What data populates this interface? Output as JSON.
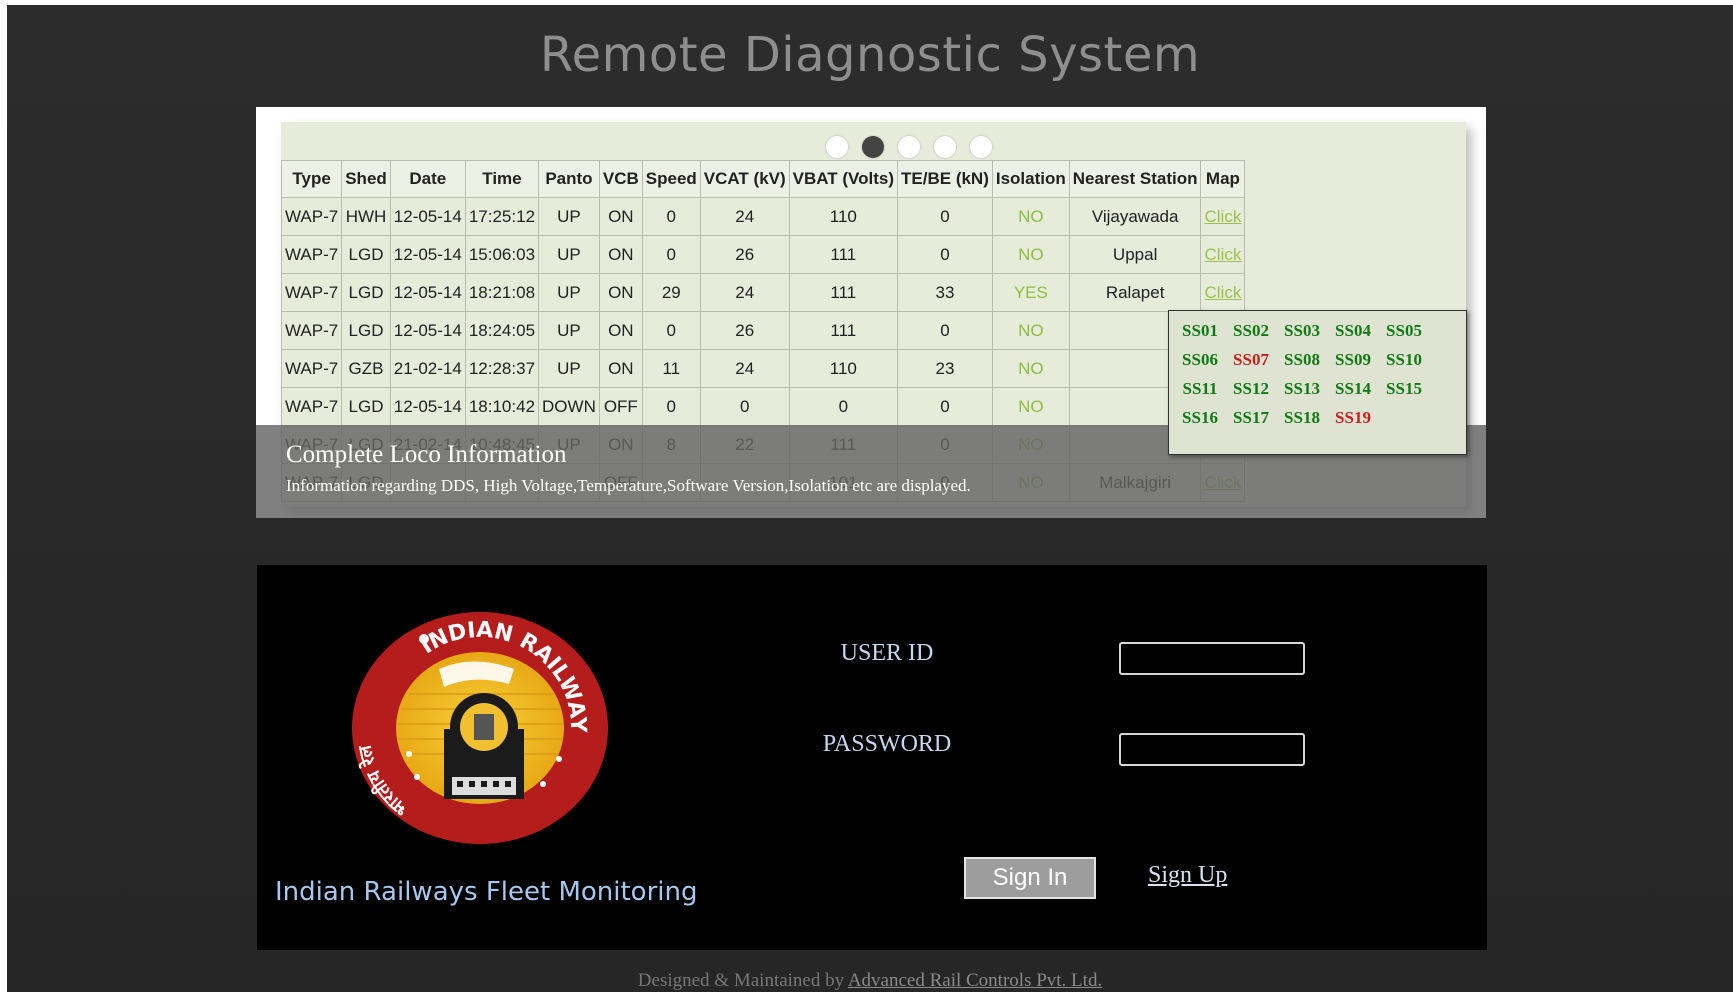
{
  "app": {
    "title": "Remote Diagnostic System"
  },
  "slider": {
    "dots": 5,
    "active_dot": 1,
    "caption_title": "Complete Loco Information",
    "caption_text": "Information regarding DDS, High Voltage,Temperature,Software Version,Isolation etc are displayed."
  },
  "table": {
    "headers": [
      "Type",
      "Shed",
      "Date",
      "Time",
      "Panto",
      "VCB",
      "Speed",
      "VCAT (kV)",
      "VBAT (Volts)",
      "TE/BE (kN)",
      "Isolation",
      "Nearest Station",
      "Map"
    ],
    "rows": [
      [
        "WAP-7",
        "HWH",
        "12-05-14",
        "17:25:12",
        "UP",
        "ON",
        "0",
        "24",
        "110",
        "0",
        "NO",
        "Vijayawada",
        "Click"
      ],
      [
        "WAP-7",
        "LGD",
        "12-05-14",
        "15:06:03",
        "UP",
        "ON",
        "0",
        "26",
        "111",
        "0",
        "NO",
        "Uppal",
        "Click"
      ],
      [
        "WAP-7",
        "LGD",
        "12-05-14",
        "18:21:08",
        "UP",
        "ON",
        "29",
        "24",
        "111",
        "33",
        "YES",
        "Ralapet",
        "Click"
      ],
      [
        "WAP-7",
        "LGD",
        "12-05-14",
        "18:24:05",
        "UP",
        "ON",
        "0",
        "26",
        "111",
        "0",
        "NO",
        "",
        ""
      ],
      [
        "WAP-7",
        "GZB",
        "21-02-14",
        "12:28:37",
        "UP",
        "ON",
        "11",
        "24",
        "110",
        "23",
        "NO",
        "",
        ""
      ],
      [
        "WAP-7",
        "LGD",
        "12-05-14",
        "18:10:42",
        "DOWN",
        "OFF",
        "0",
        "0",
        "0",
        "0",
        "NO",
        "",
        ""
      ],
      [
        "WAP-7",
        "LGD",
        "21-02-14",
        "10:48:45",
        "UP",
        "ON",
        "8",
        "22",
        "111",
        "0",
        "NO",
        "",
        ""
      ],
      [
        "WAP-7",
        "LGD",
        "",
        "",
        "",
        "OFF",
        "",
        "",
        "101",
        "0",
        "NO",
        "Malkajgiri",
        "Click"
      ]
    ]
  },
  "substations": {
    "items": [
      "SS01",
      "SS02",
      "SS03",
      "SS04",
      "SS05",
      "SS06",
      "SS07",
      "SS08",
      "SS09",
      "SS10",
      "SS11",
      "SS12",
      "SS13",
      "SS14",
      "SS15",
      "SS16",
      "SS17",
      "SS18",
      "SS19"
    ],
    "alert_items": [
      "SS07",
      "SS19"
    ],
    "ok_color": "#0f7a14",
    "alert_color": "#cc1d1d"
  },
  "login": {
    "logo_text_top": "INDIAN RAILWAYS",
    "logo_text_left": "भारतीय रेल",
    "org_label": "Indian Railways Fleet Monitoring",
    "user_id_label": "USER ID",
    "password_label": "PASSWORD",
    "user_id_value": "",
    "password_value": "",
    "sign_in_label": "Sign In",
    "sign_up_label": "Sign Up"
  },
  "footer": {
    "prefix": "Designed & Maintained by",
    "company": "Advanced Rail Controls Pvt. Ltd."
  }
}
